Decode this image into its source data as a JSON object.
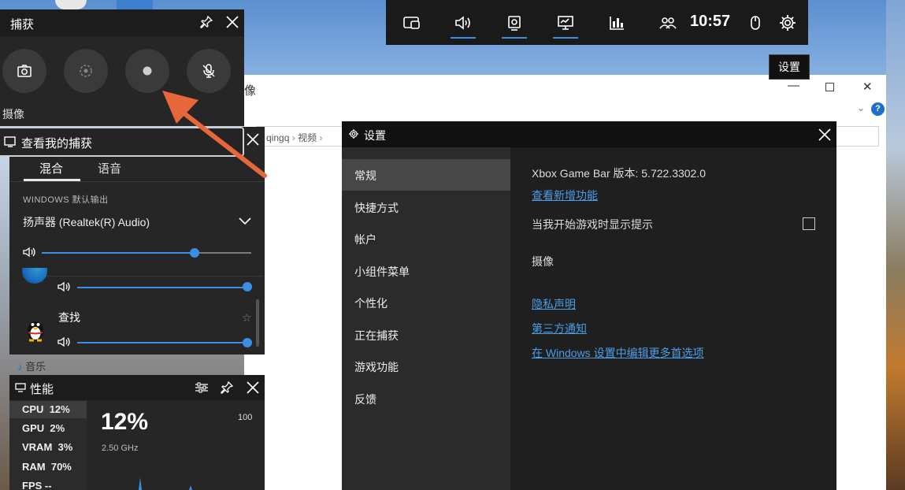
{
  "taskbar": {
    "time": "10:57",
    "settings_tooltip": "设置",
    "buttons": [
      "widget-menu-icon",
      "audio-icon",
      "capture-icon",
      "performance-icon",
      "resources-icon",
      "social-icon"
    ]
  },
  "explorer": {
    "path_tail": "qingq",
    "path_seg": "视频",
    "title_frag": "像"
  },
  "capture": {
    "title": "捕获",
    "label": "摄像",
    "view_captures": "查看我的捕获"
  },
  "audio": {
    "tabs": [
      "混合",
      "语音"
    ],
    "section": "WINDOWS 默认输出",
    "device": "扬声器 (Realtek(R) Audio)",
    "master_level": 0.83,
    "app1_level": 1.0,
    "app2_name": "查找",
    "app2_level": 1.0
  },
  "music_label": "音乐",
  "performance": {
    "title": "性能",
    "rows": [
      {
        "label": "CPU",
        "value": "12%"
      },
      {
        "label": "GPU",
        "value": "2%"
      },
      {
        "label": "VRAM",
        "value": "3%"
      },
      {
        "label": "RAM",
        "value": "70%"
      },
      {
        "label": "FPS",
        "value": "--"
      }
    ],
    "big_value": "12%",
    "clock": "2.50 GHz",
    "max": "100"
  },
  "settings": {
    "title": "设置",
    "nav": [
      "常规",
      "快捷方式",
      "帐户",
      "小组件菜单",
      "个性化",
      "正在捕获",
      "游戏功能",
      "反馈"
    ],
    "selected": 0,
    "version": "Xbox Game Bar 版本: 5.722.3302.0",
    "whats_new": "查看新增功能",
    "show_tips": "当我开始游戏时显示提示",
    "show_tips_checked": false,
    "camera_heading": "摄像",
    "privacy": "隐私声明",
    "third_party": "第三方通知",
    "edit_more": "在 Windows 设置中编辑更多首选项"
  },
  "colors": {
    "accent": "#3a8ee6",
    "link": "#4a9de8",
    "arrow": "#e8673a"
  }
}
